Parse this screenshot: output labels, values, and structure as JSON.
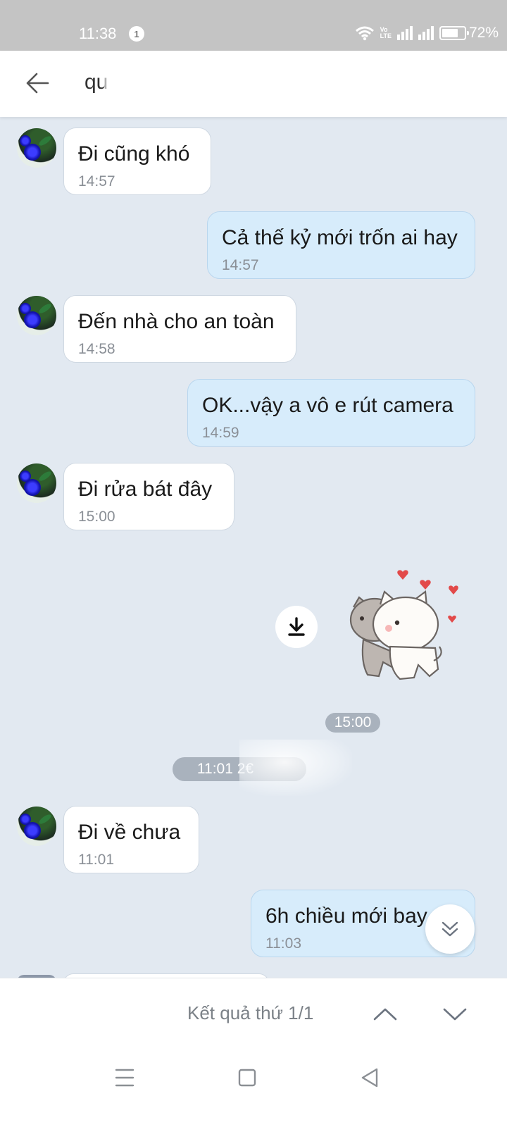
{
  "status_bar": {
    "time": "11:38",
    "notification_count": "1",
    "network_label_top": "Vo",
    "network_label_bottom": "LTE",
    "battery": "72%"
  },
  "header": {
    "title_visible": "qu",
    "back_icon": "arrow-left-icon"
  },
  "messages": [
    {
      "direction": "in",
      "text": "Đi cũng khó",
      "time": "14:57"
    },
    {
      "direction": "out",
      "text": "Cả thế kỷ mới trốn ai hay",
      "time": "14:57"
    },
    {
      "direction": "in",
      "text": "Đến nhà cho an toàn",
      "time": "14:58"
    },
    {
      "direction": "out",
      "text": "OK...vậy a vô e rút camera",
      "time": "14:59"
    },
    {
      "direction": "in",
      "text": "Đi rửa bát đây",
      "time": "15:00"
    },
    {
      "direction": "in",
      "text": "Đi về chưa",
      "time": "11:01"
    },
    {
      "direction": "out",
      "text": "6h chiều mới bay",
      "time": "11:03"
    }
  ],
  "sticker": {
    "time": "15:00",
    "download_icon": "download-icon"
  },
  "date_separator": "11:01 2€",
  "search_results": {
    "label": "Kết quả thứ 1/1",
    "prev_icon": "chevron-up-icon",
    "next_icon": "chevron-down-icon"
  },
  "colors": {
    "chat_background": "#e2e9f1",
    "outgoing_bubble": "#d7ecfb",
    "incoming_bubble": "#ffffff",
    "status_bar": "#c4c4c4",
    "pill": "#a9b2bd"
  }
}
